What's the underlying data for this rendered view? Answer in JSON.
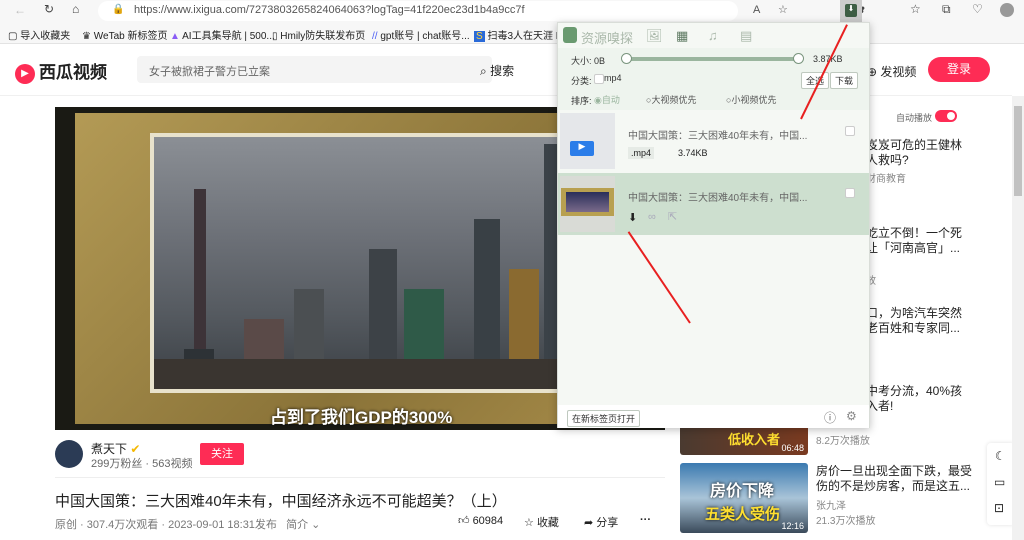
{
  "browser": {
    "url": "https://www.ixigua.com/7273803265824064063?logTag=41f220ec23d1b4a9cc7f",
    "bookmarks": [
      "导入收藏夹",
      "WeTab 新标签页",
      "AI工具集导航 | 500...",
      "Hmily防失联发布页",
      "gpt账号 | chat账号...",
      "扫毒3人在天涯 HD"
    ]
  },
  "site": {
    "logo": "西瓜视频",
    "search_placeholder": "女子被掀裙子警方已立案",
    "search_label": "搜索",
    "upload_label": "发视频",
    "login_label": "登录",
    "autoplay_label": "自动播放"
  },
  "video": {
    "subtitle": "占到了我们GDP的300%",
    "author": "煮天下",
    "author_stats": "299万粉丝 · 563视频",
    "follow_label": "关注",
    "title": "中国大国策：三大困难40年未有，中国经济永远不可能超美？（上）",
    "meta": "原创 · 307.4万次观看 · 2023-09-01 18:31发布",
    "intro_label": "简介",
    "likes": "60984",
    "collect_label": "收藏",
    "share_label": "分享"
  },
  "recommend": [
    {
      "title1": "岌岌可危的王健林",
      "title2": "人救吗?",
      "author": "财商教育"
    },
    {
      "title1": "屹立不倒！一个死",
      "title2": "让「河南高官」...",
      "author": "放"
    },
    {
      "title1": "口，为啥汽车突然",
      "title2": "老百姓和专家同...",
      "author": ""
    },
    {
      "title1": "中考分流，40%孩",
      "title2": "入者!",
      "author": "",
      "views": "8.2万次播放",
      "thumb_text": "低收入者",
      "duration": "06:48"
    },
    {
      "title1": "房价一旦出现全面下跌，最受",
      "title2": "伤的不是炒房客，而是这五...",
      "author": "张九泽",
      "views": "21.3万次播放",
      "thumb_text1": "房价下降",
      "thumb_text2": "五类人受伤",
      "duration": "12:16"
    }
  ],
  "popup": {
    "title": "资源嗅探",
    "size_label": "大小: 0B",
    "size_max": "3.87KB",
    "category_label": "分类:",
    "category_opt": "mp4",
    "select_all": "全选",
    "download": "下载",
    "sort_label": "排序:",
    "sort_options": [
      "自动",
      "大视频优先",
      "小视频优先"
    ],
    "sort_selected": 0,
    "items": [
      {
        "name": "中国大国策：三大困难40年未有，中国...",
        "ext": ".mp4",
        "size": "3.74KB"
      },
      {
        "name": "中国大国策：三大困难40年未有，中国..."
      }
    ],
    "open_tab": "在新标签页打开",
    "accent": "#5e8a64"
  }
}
